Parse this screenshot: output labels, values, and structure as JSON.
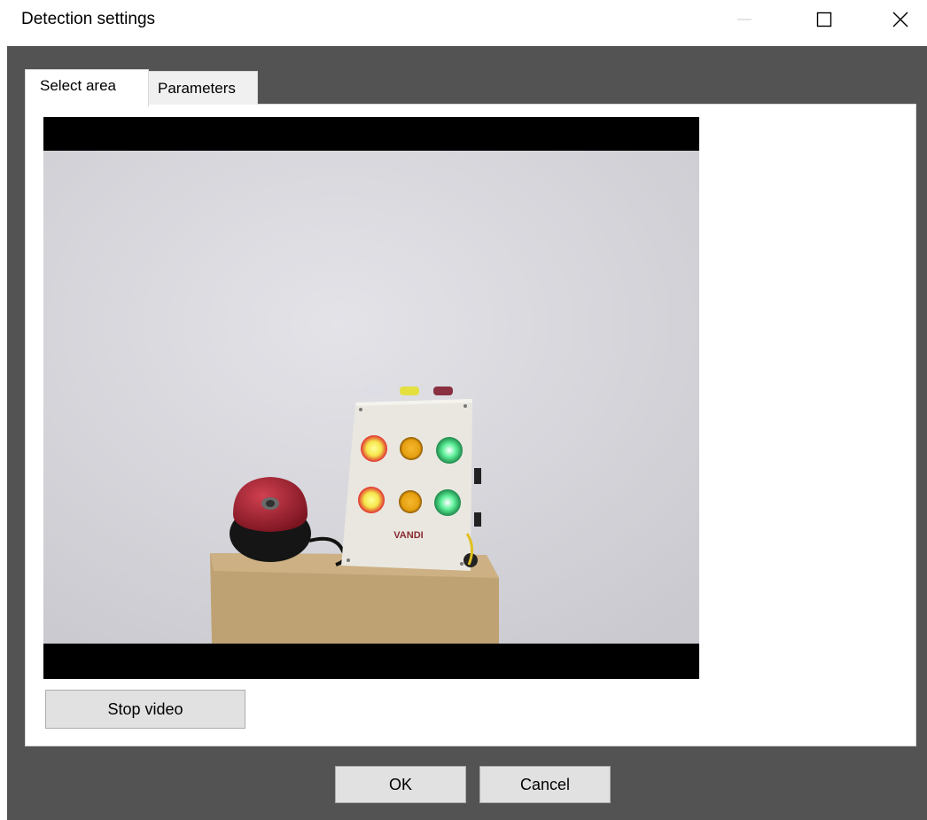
{
  "window": {
    "title": "Detection settings",
    "controls": {
      "minimize": "minimize-icon",
      "maximize": "maximize-icon",
      "close": "close-icon"
    }
  },
  "tabs": [
    {
      "label": "Select area",
      "active": true
    },
    {
      "label": "Parameters",
      "active": false
    }
  ],
  "video": {
    "box_brand": "VANDI",
    "lamp_colors": [
      "#f5e64a",
      "#e6a010",
      "#5ff09a"
    ]
  },
  "buttons": {
    "stop_video": "Stop video",
    "ok": "OK",
    "cancel": "Cancel"
  },
  "colors": {
    "frame_background": "#535353",
    "button_face": "#e1e1e1",
    "button_border": "#adadad"
  }
}
